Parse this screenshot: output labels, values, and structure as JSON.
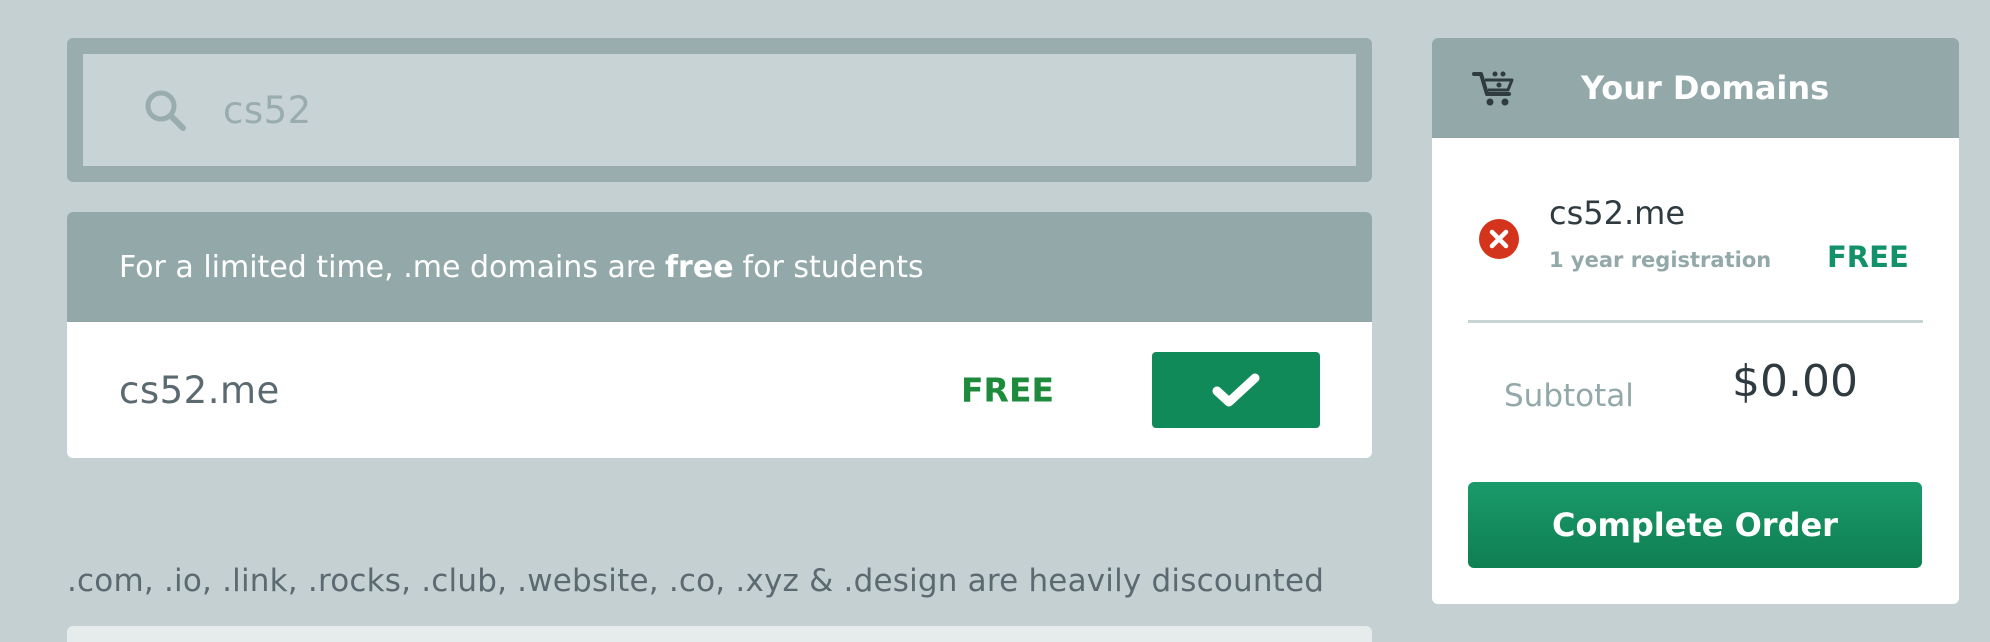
{
  "search": {
    "value": "cs52",
    "icon": "search-icon"
  },
  "promo": {
    "prefix": "For a limited time, .me domains are",
    "highlight": "free",
    "suffix": "for students",
    "domain": "cs52.me",
    "price": "FREE",
    "select_icon": "check-icon"
  },
  "discount_notice": ".com, .io, .link, .rocks, .club, .website, .co, .xyz & .design are heavily discounted",
  "cart": {
    "icon": "cart-icon",
    "title": "Your Domains",
    "items": [
      {
        "domain": "cs52.me",
        "term": "1 year registration",
        "price": "FREE",
        "remove_icon": "remove-icon"
      }
    ],
    "subtotal_label": "Subtotal",
    "subtotal_value": "$0.00",
    "complete_label": "Complete Order"
  },
  "colors": {
    "background": "#c5d0d3",
    "header": "#93a8a9",
    "accent_green": "#118a5a",
    "price_green": "#1d8a3c",
    "remove_red": "#d4341c"
  }
}
